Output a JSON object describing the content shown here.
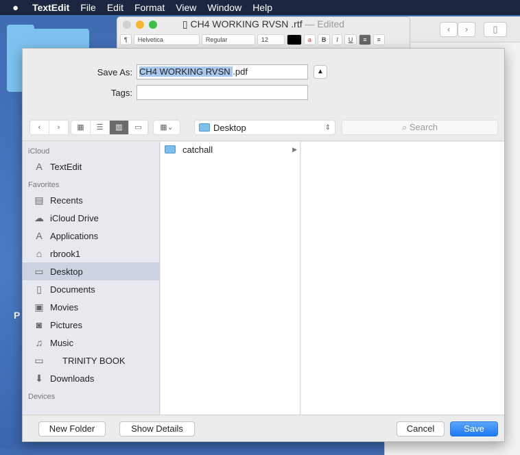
{
  "menubar": {
    "apple": "",
    "app": "TextEdit",
    "items": [
      "File",
      "Edit",
      "Format",
      "View",
      "Window",
      "Help"
    ]
  },
  "desktop": {
    "label": "P"
  },
  "textedit": {
    "filename": "CH4 WORKING RVSN .rtf",
    "separator": "—",
    "status": "Edited",
    "format": {
      "paragraph": "¶",
      "font": "Helvetica",
      "style": "Regular",
      "size": "12",
      "bold": "B",
      "italic": "I",
      "underline": "U"
    }
  },
  "save": {
    "save_as_label": "Save As:",
    "filename_selected": "CH4 WORKING RVSN ",
    "filename_ext": ".pdf",
    "tags_label": "Tags:",
    "tags_value": "",
    "location": "Desktop",
    "search_placeholder": "Search"
  },
  "sidebar": {
    "sections": [
      {
        "title": "iCloud",
        "items": [
          {
            "label": "TextEdit",
            "icon": "app-icon"
          }
        ]
      },
      {
        "title": "Favorites",
        "items": [
          {
            "label": "Recents",
            "icon": "recents-icon"
          },
          {
            "label": "iCloud Drive",
            "icon": "cloud-icon"
          },
          {
            "label": "Applications",
            "icon": "applications-icon"
          },
          {
            "label": "rbrook1",
            "icon": "home-icon"
          },
          {
            "label": "Desktop",
            "icon": "desktop-icon",
            "selected": true
          },
          {
            "label": "Documents",
            "icon": "documents-icon"
          },
          {
            "label": "Movies",
            "icon": "movies-icon"
          },
          {
            "label": "Pictures",
            "icon": "camera-icon"
          },
          {
            "label": "Music",
            "icon": "music-icon"
          },
          {
            "label": "TRINITY BOOK",
            "icon": "folder-icon"
          },
          {
            "label": "Downloads",
            "icon": "downloads-icon"
          }
        ]
      },
      {
        "title": "Devices",
        "items": []
      }
    ]
  },
  "files": [
    {
      "name": "catchall",
      "has_children": true
    }
  ],
  "buttons": {
    "new_folder": "New Folder",
    "show_details": "Show Details",
    "cancel": "Cancel",
    "save": "Save"
  }
}
